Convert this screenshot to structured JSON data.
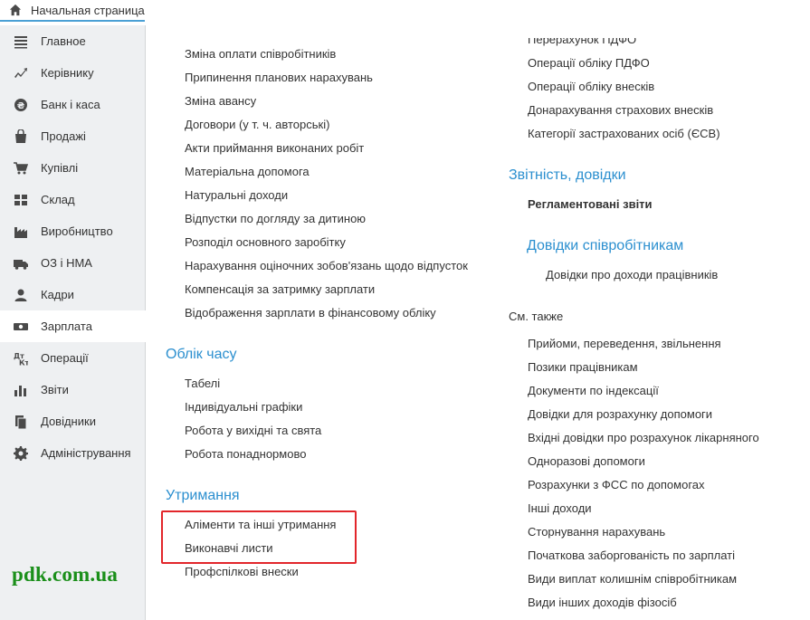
{
  "top_tab": {
    "label": "Начальная страница",
    "icon": "home-icon"
  },
  "sidebar": {
    "items": [
      {
        "label": "Главное",
        "icon": "menu-lines-icon"
      },
      {
        "label": "Керівнику",
        "icon": "trend-chart-icon"
      },
      {
        "label": "Банк і каса",
        "icon": "coin-icon"
      },
      {
        "label": "Продажі",
        "icon": "shopping-bag-icon"
      },
      {
        "label": "Купівлі",
        "icon": "cart-icon"
      },
      {
        "label": "Склад",
        "icon": "warehouse-grid-icon"
      },
      {
        "label": "Виробництво",
        "icon": "factory-icon"
      },
      {
        "label": "ОЗ і НМА",
        "icon": "truck-icon"
      },
      {
        "label": "Кадри",
        "icon": "person-icon"
      },
      {
        "label": "Зарплата",
        "icon": "money-icon",
        "active": true
      },
      {
        "label": "Операції",
        "icon": "debit-credit-icon"
      },
      {
        "label": "Звіти",
        "icon": "bar-chart-icon"
      },
      {
        "label": "Довідники",
        "icon": "books-icon"
      },
      {
        "label": "Адміністрування",
        "icon": "gear-icon"
      }
    ]
  },
  "watermark": "pdk.com.ua",
  "left_column": {
    "top_links": [
      "Зміна оплати співробітників",
      "Припинення планових нарахувань",
      "Зміна авансу",
      "Договори (у т. ч. авторські)",
      "Акти приймання виконаних робіт",
      "Матеріальна допомога",
      "Натуральні доходи",
      "Відпустки по догляду за дитиною",
      "Розподіл основного заробітку",
      "Нарахування оціночних зобов'язань щодо відпусток",
      "Компенсація за затримку зарплати",
      "Відображення зарплати в фінансовому обліку"
    ],
    "time_section": {
      "title": "Облік часу",
      "links": [
        "Табелі",
        "Індивідуальні графіки",
        "Робота у вихідні та свята",
        "Робота понаднормово"
      ]
    },
    "deductions_section": {
      "title": "Утримання",
      "links": [
        "Аліменти та інші утримання",
        "Виконавчі листи",
        "Профспілкові внески"
      ]
    }
  },
  "right_column": {
    "cut_link": "Перерахунок ПДФО",
    "top_links": [
      "Операції обліку ПДФО",
      "Операції обліку внесків",
      "Донарахування страхових внесків",
      "Категорії застрахованих осіб (ЄСВ)"
    ],
    "reports_section": {
      "title": "Звітність, довідки",
      "bold_link": "Регламентовані звіти"
    },
    "employee_refs_section": {
      "title": "Довідки співробітникам",
      "links": [
        "Довідки про доходи працівників"
      ]
    },
    "see_also": {
      "title": "См. также",
      "links": [
        "Прийоми, переведення, звільнення",
        "Позики працівникам",
        "Документи по індексації",
        "Довідки для розрахунку допомоги",
        "Вхідні довідки про розрахунок лікарняного",
        "Одноразові допомоги",
        "Розрахунки з ФСС по допомогах",
        "Інші доходи",
        "Сторнування нарахувань",
        "Початкова заборгованість по зарплаті",
        "Види виплат колишнім співробітникам",
        "Види інших доходів фізосіб"
      ]
    }
  },
  "colors": {
    "accent": "#2b8fcf",
    "highlight": "#e2262b",
    "watermark": "#1a8f1a",
    "sidebar_bg": "#eef0f2"
  }
}
